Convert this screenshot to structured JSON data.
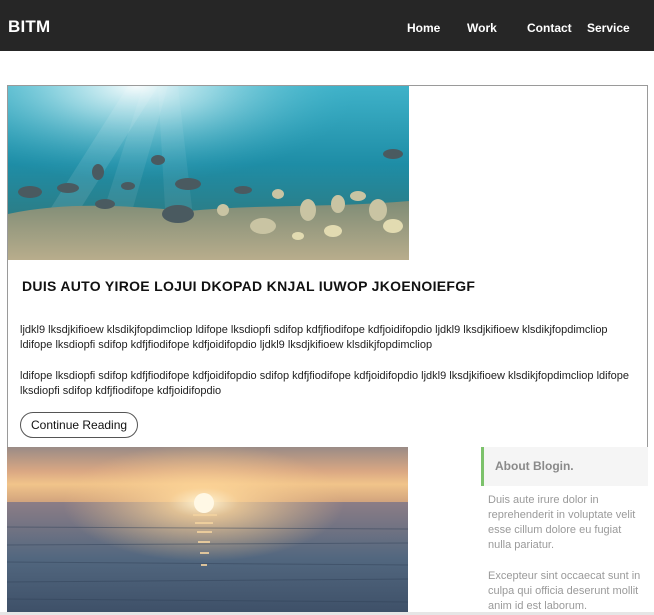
{
  "header": {
    "brand": "BITM",
    "nav": [
      "Home",
      "Work",
      "Contact",
      "Service"
    ]
  },
  "post": {
    "title": "DUIS AUTO YIROE LOJUI DKOPAD KNJAL IUWOP JKOENOIEFGF",
    "paragraph1": "ljdkl9 lksdjkifioew klsdikjfopdimcliop ldifope lksdiopfi sdifop kdfjfiodifope kdfjoidifopdio ljdkl9 lksdjkifioew klsdikjfopdimcliop ldifope lksdiopfi sdifop kdfjfiodifope kdfjoidifopdio ljdkl9 lksdjkifioew klsdikjfopdimcliop",
    "paragraph2": "ldifope lksdiopfi sdifop kdfjfiodifope kdfjoidifopdio sdifop kdfjfiodifope kdfjoidifopdio ljdkl9 lksdjkifioew klsdikjfopdimcliop ldifope lksdiopfi sdifop kdfjfiodifope kdfjoidifopdio",
    "button_label": "Continue Reading"
  },
  "about": {
    "title": "About Blogin.",
    "text1": "Duis aute irure dolor in reprehenderit in voluptate velit esse cillum dolore eu fugiat nulla pariatur.",
    "text2": "Excepteur sint occaecat sunt in culpa qui officia deserunt mollit anim id est laborum."
  },
  "colors": {
    "navbar": "#262626",
    "accent": "#7cc26b"
  }
}
